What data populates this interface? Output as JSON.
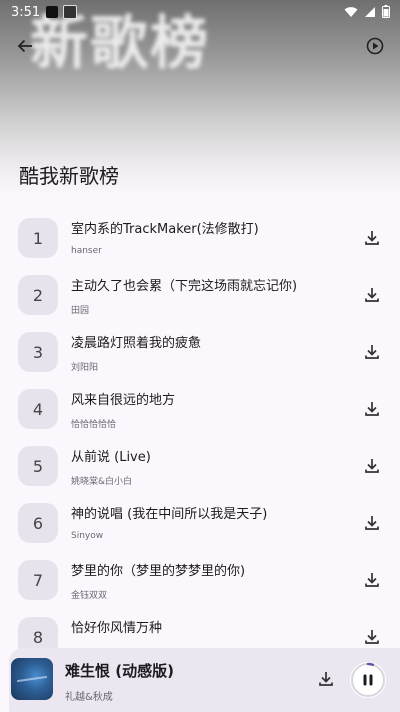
{
  "status": {
    "time": "3:51"
  },
  "header": {
    "banner_text": "新歌榜",
    "title": "酷我新歌榜"
  },
  "songs": [
    {
      "rank": "1",
      "title": "室内系的TrackMaker(法修散打)",
      "artist": "hanser"
    },
    {
      "rank": "2",
      "title": "主动久了也会累（下完这场雨就忘记你)",
      "artist": "田园"
    },
    {
      "rank": "3",
      "title": "凌晨路灯照着我的疲惫",
      "artist": "刘阳阳"
    },
    {
      "rank": "4",
      "title": "风来自很远的地方",
      "artist": "恰恰恰恰恰"
    },
    {
      "rank": "5",
      "title": "从前说 (Live)",
      "artist": "姚晓棠&白小白"
    },
    {
      "rank": "6",
      "title": "神的说唱 (我在中间所以我是天子)",
      "artist": "Sinyow"
    },
    {
      "rank": "7",
      "title": "梦里的你（梦里的梦梦里的你)",
      "artist": "金钰双双"
    },
    {
      "rank": "8",
      "title": "恰好你风情万种",
      "artist": ""
    }
  ],
  "player": {
    "title": "难生恨 (动感版)",
    "artist": "礼越&秋成",
    "progress": 0.05
  }
}
